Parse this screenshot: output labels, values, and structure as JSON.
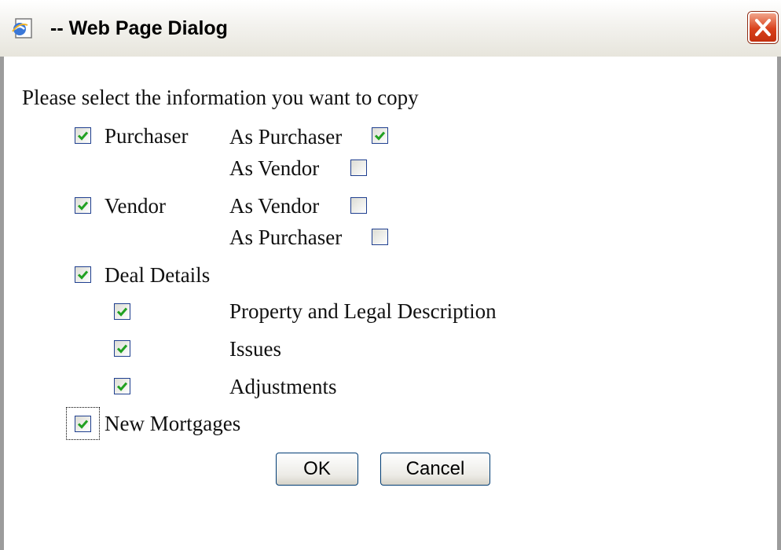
{
  "window": {
    "title": "-- Web Page Dialog",
    "icon": "ie-page-icon",
    "close_icon": "close-icon"
  },
  "dialog": {
    "prompt": "Please select the information you want to copy",
    "purchaser": {
      "label": "Purchaser",
      "checked": true,
      "options": [
        {
          "label": "As Purchaser",
          "checked": true
        },
        {
          "label": "As Vendor",
          "checked": false
        }
      ]
    },
    "vendor": {
      "label": "Vendor",
      "checked": true,
      "options": [
        {
          "label": "As Vendor",
          "checked": false
        },
        {
          "label": "As Purchaser",
          "checked": false
        }
      ]
    },
    "deal_details": {
      "label": "Deal Details",
      "checked": true,
      "items": [
        {
          "label": "Property and Legal Description",
          "checked": true
        },
        {
          "label": "Issues",
          "checked": true
        },
        {
          "label": "Adjustments",
          "checked": true
        }
      ]
    },
    "new_mortgages": {
      "label": "New Mortgages",
      "checked": true
    },
    "ok_label": "OK",
    "cancel_label": "Cancel"
  },
  "colors": {
    "check": "#21a121",
    "checkbox_border": "#1f3f8f",
    "close_button": "#d9411c"
  }
}
